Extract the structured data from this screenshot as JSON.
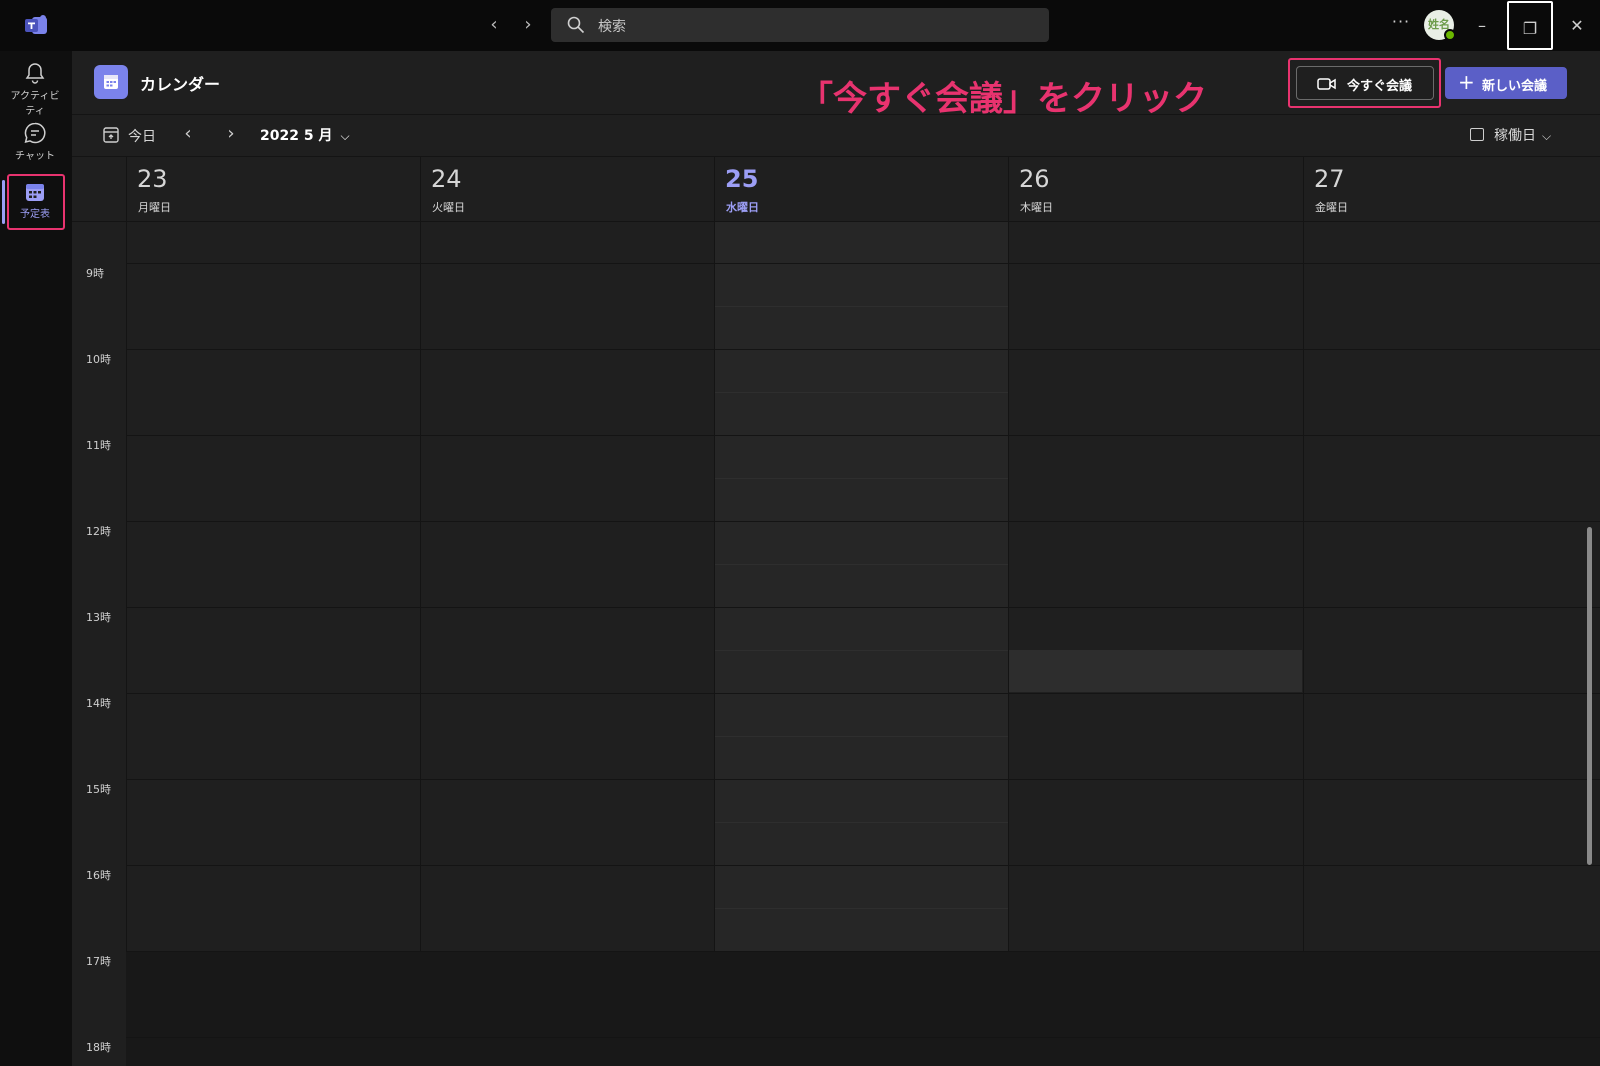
{
  "titlebar": {
    "back_label": "‹",
    "forward_label": "›",
    "search_placeholder": "検索",
    "more_label": "···",
    "avatar_initials": "姓名",
    "minimize_label": "–",
    "restore_label": "❐",
    "close_label": "✕"
  },
  "rail": {
    "items": [
      {
        "label": "アクティビティ",
        "icon": "bell-icon"
      },
      {
        "label": "チャット",
        "icon": "chat-icon"
      },
      {
        "label": "予定表",
        "icon": "calendar-icon",
        "active": true
      }
    ]
  },
  "header": {
    "title": "カレンダー",
    "annotation": "「今すぐ会議」をクリック",
    "meet_now_label": "今すぐ会議",
    "new_meeting_label": "新しい会議",
    "new_meeting_plus": "+"
  },
  "toolbar": {
    "today_label": "今日",
    "prev_label": "‹",
    "next_label": "›",
    "month_label": "2022 5 月",
    "month_chevron": "⌵",
    "view_label": "稼働日",
    "view_chevron": "⌵"
  },
  "days": [
    {
      "num": "23",
      "name": "月曜日"
    },
    {
      "num": "24",
      "name": "火曜日"
    },
    {
      "num": "25",
      "name": "水曜日",
      "today": true
    },
    {
      "num": "26",
      "name": "木曜日"
    },
    {
      "num": "27",
      "name": "金曜日"
    }
  ],
  "hours": [
    "9時",
    "10時",
    "11時",
    "12時",
    "13時",
    "14時",
    "15時",
    "16時",
    "17時",
    "18時"
  ],
  "colors": {
    "accent": "#5b5fc7",
    "today": "#9c9ef5",
    "annotation": "#e8336f",
    "status_available": "#6bb700"
  }
}
